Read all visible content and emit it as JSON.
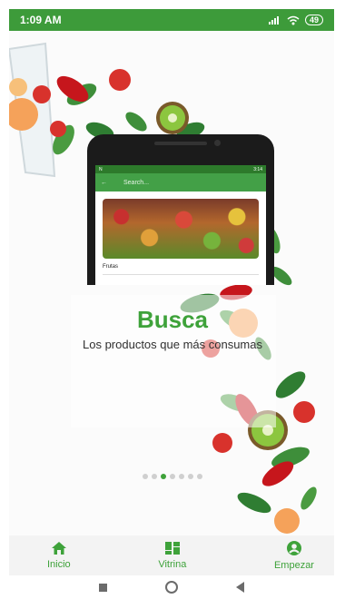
{
  "status_bar": {
    "time": "1:09 AM",
    "battery": "49"
  },
  "preview": {
    "status_time": "3:14",
    "search_placeholder": "Search...",
    "card_label": "Frutas"
  },
  "onboarding": {
    "title": "Busca",
    "subtitle": "Los productos que más consumas",
    "page_count": 7,
    "active_page": 3
  },
  "bottom_nav": {
    "items": [
      {
        "label": "Inicio",
        "icon": "home-icon"
      },
      {
        "label": "Vitrina",
        "icon": "grid-icon"
      },
      {
        "label": "Empezar",
        "icon": "account-icon"
      }
    ]
  },
  "colors": {
    "primary": "#3d9b3a",
    "accent_text": "#3ea23a"
  }
}
